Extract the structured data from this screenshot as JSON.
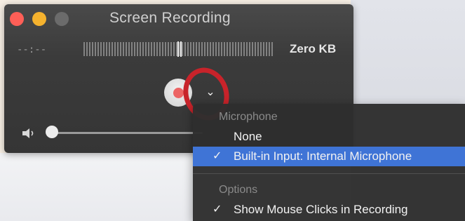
{
  "window": {
    "title": "Screen Recording",
    "elapsed_time": "--:--",
    "file_size": "Zero KB",
    "options_chevron": "⌄"
  },
  "colors": {
    "close": "#ff5f57",
    "minimize": "#f5b22e",
    "record_dot": "#ec6464",
    "selection": "#3f74d6",
    "annotation": "#c8232a"
  },
  "icons": [
    "close-icon",
    "minimize-icon",
    "maximize-icon",
    "record-icon",
    "chevron-down-icon",
    "speaker-icon",
    "checkmark-icon"
  ],
  "menu": {
    "section_microphone": "Microphone",
    "none_label": "None",
    "builtin_label": "Built-in Input: Internal Microphone",
    "builtin_checked": "✓",
    "section_options": "Options",
    "show_clicks_label": "Show Mouse Clicks in Recording",
    "show_clicks_checked": "✓"
  }
}
